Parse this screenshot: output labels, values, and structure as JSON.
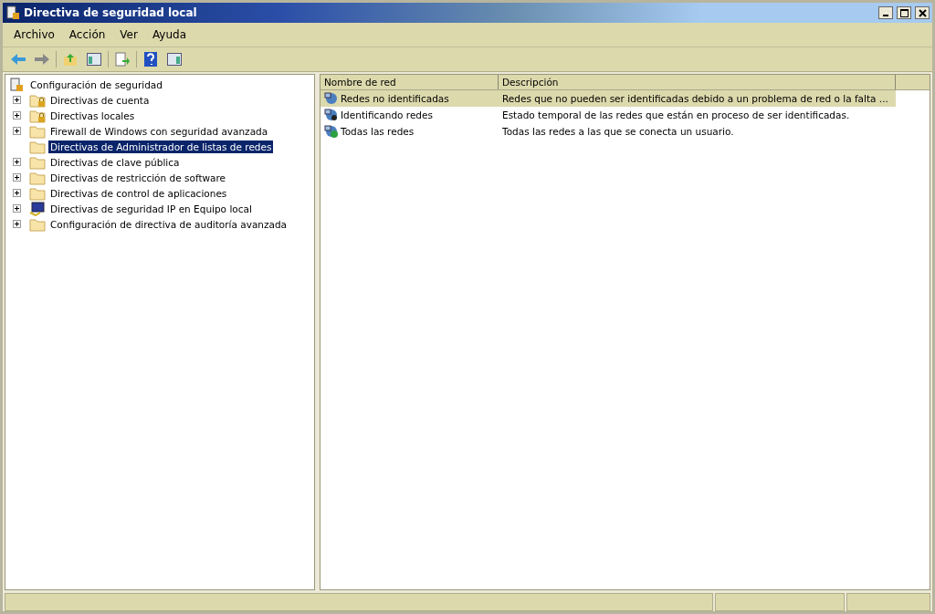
{
  "window": {
    "title": "Directiva de seguridad local"
  },
  "menu": [
    "Archivo",
    "Acción",
    "Ver",
    "Ayuda"
  ],
  "tree": {
    "root": "Configuración de seguridad",
    "children": [
      {
        "label": "Directivas de cuenta",
        "kind": "locked",
        "expandable": true,
        "selected": false
      },
      {
        "label": "Directivas locales",
        "kind": "locked",
        "expandable": true,
        "selected": false
      },
      {
        "label": "Firewall de Windows con seguridad avanzada",
        "kind": "folder",
        "expandable": true,
        "selected": false
      },
      {
        "label": "Directivas de Administrador de listas de redes",
        "kind": "folder",
        "expandable": false,
        "selected": true
      },
      {
        "label": "Directivas de clave pública",
        "kind": "folder",
        "expandable": true,
        "selected": false
      },
      {
        "label": "Directivas de restricción de software",
        "kind": "folder",
        "expandable": true,
        "selected": false
      },
      {
        "label": "Directivas de control de aplicaciones",
        "kind": "folder",
        "expandable": true,
        "selected": false
      },
      {
        "label": "Directivas de seguridad IP en Equipo local",
        "kind": "computer",
        "expandable": true,
        "selected": false
      },
      {
        "label": "Configuración de directiva de auditoría avanzada",
        "kind": "folder",
        "expandable": true,
        "selected": false
      }
    ]
  },
  "table": {
    "columns": [
      "Nombre de red",
      "Descripción"
    ],
    "rows": [
      {
        "name": "Redes no identificadas",
        "description": "Redes que no pueden ser identificadas debido a un problema de red o la falta ...",
        "selected": true
      },
      {
        "name": "Identificando redes",
        "description": "Estado temporal de las redes que están en proceso de ser identificadas.",
        "selected": false
      },
      {
        "name": "Todas las redes",
        "description": "Todas las redes a las que se conecta un usuario.",
        "selected": false
      }
    ]
  }
}
